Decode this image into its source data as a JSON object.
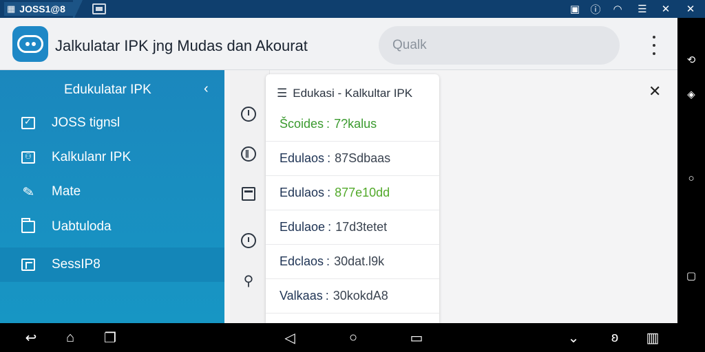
{
  "window": {
    "app_title": "JOSS1@8"
  },
  "header": {
    "title": "Jalkulatar IPK jng Mudas dan Akourat",
    "search_placeholder": "Qualk"
  },
  "sidebar": {
    "title": "Edukulatar IPK",
    "items": [
      {
        "label": "JOSS tignsl",
        "icon": "checkbox-icon"
      },
      {
        "label": "Kalkulanr IPK",
        "icon": "calculator-icon"
      },
      {
        "label": "Mate",
        "icon": "pencil-icon"
      },
      {
        "label": "Uabtuloda",
        "icon": "folder-icon"
      },
      {
        "label": "SessIP8",
        "icon": "tablet-icon"
      }
    ],
    "active_index": 4
  },
  "panel": {
    "title": "Edukasi - Kalkultar IPK",
    "rows": [
      {
        "key": "Šcoides",
        "sep": ":",
        "value": "7?kalus",
        "style": "green"
      },
      {
        "key": "Edulaos",
        "sep": ":",
        "value": "87Sdbaas",
        "style": "plain"
      },
      {
        "key": "Edulaos",
        "sep": ":",
        "value": "877e10dd",
        "style": "green-value"
      },
      {
        "key": "Edulaoe",
        "sep": ":",
        "value": "17d3tetet",
        "style": "plain"
      },
      {
        "key": "Edclaos",
        "sep": ":",
        "value": "30dat.l9k",
        "style": "plain"
      },
      {
        "key": "Valkaas",
        "sep": ":",
        "value": "30kokdA8",
        "style": "plain"
      }
    ]
  },
  "colors": {
    "sidebar": "#1b87bd",
    "titlebar": "#0f3f6e",
    "accent_green": "#3a9a2e"
  }
}
